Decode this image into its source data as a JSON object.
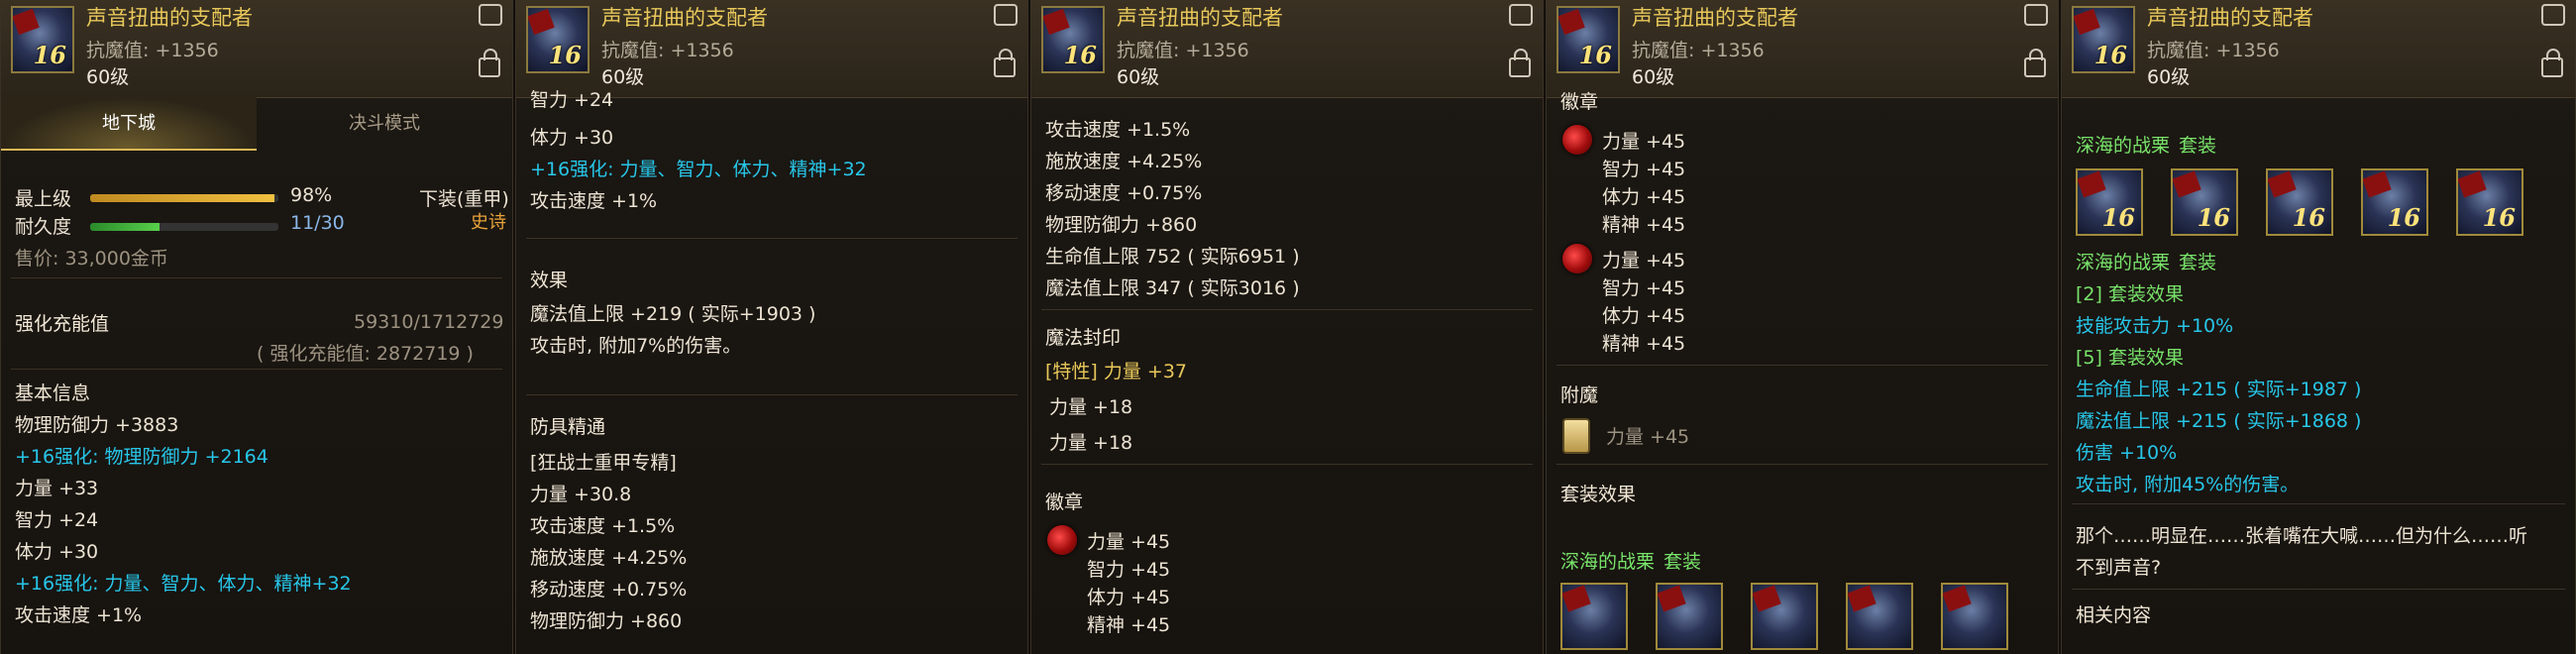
{
  "item": {
    "name": "声音扭曲的支配者",
    "magic_resist": "抗魔值: +1356",
    "level": "60级",
    "icon_level": "16"
  },
  "panel1": {
    "tab_dungeon": "地下城",
    "tab_pvp": "决斗模式",
    "grade_label": "最上级",
    "grade_value": "98%",
    "grade_fraction": 0.98,
    "slot": "下装(重甲)",
    "rarity": "史诗",
    "durability_label": "耐久度",
    "durability_value": "11/30",
    "durability_fraction": 0.3667,
    "price": "售价: 33,000金币",
    "charge_label": "强化充能值",
    "charge_value": "59310/1712729",
    "charge_sub": "( 强化充能值: 2872719 )",
    "basic_info": "基本信息",
    "phys_def": "物理防御力 +3883",
    "reinforce_def": "+16强化: 物理防御力 +2164",
    "str": "力量 +33",
    "int": "智力 +24",
    "vit": "体力 +30",
    "reinforce_stats": "+16强化: 力量、智力、体力、精神+32",
    "atk_speed": "攻击速度 +1%"
  },
  "panel2": {
    "int_partial": "智力 +24",
    "vit": "体力 +30",
    "reinforce_stats": "+16强化: 力量、智力、体力、精神+32",
    "atk_speed": "攻击速度 +1%",
    "effect_head": "效果",
    "effect_mp": "魔法值上限 +219 ( 实际+1903 )",
    "effect_dmg": "攻击时, 附加7%的伤害。",
    "mastery_head": "防具精通",
    "mastery_class": "[狂战士重甲专精]",
    "mastery_str": "力量 +30.8",
    "mastery_atk": "攻击速度 +1.5%",
    "mastery_cast": "施放速度 +4.25%",
    "mastery_move": "移动速度 +0.75%",
    "mastery_def": "物理防御力 +860"
  },
  "panel3": {
    "atk": "攻击速度 +1.5%",
    "cast": "施放速度 +4.25%",
    "move": "移动速度 +0.75%",
    "def": "物理防御力 +860",
    "hp": "生命值上限 752 ( 实际6951 )",
    "mp": "魔法值上限 347 ( 实际3016 )",
    "seal_head": "魔法封印",
    "seal_trait": "[特性] 力量 +37",
    "seal_str1": "力量 +18",
    "seal_str2": "力量 +18",
    "emblem_head": "徽章",
    "emb_str": "力量 +45",
    "emb_int": "智力 +45",
    "emb_vit": "体力 +45",
    "emb_spi": "精神 +45"
  },
  "panel4": {
    "emblem_partial": "徽章",
    "e1_str": "力量 +45",
    "e1_int": "智力 +45",
    "e1_vit": "体力 +45",
    "e1_spi": "精神 +45",
    "e2_str": "力量 +45",
    "e2_int": "智力 +45",
    "e2_vit": "体力 +45",
    "e2_spi": "精神 +45",
    "enchant_head": "附魔",
    "enchant_str": "力量 +45",
    "set_effect_head": "套装效果",
    "set_name": "深海的战栗",
    "set_tag": "套装"
  },
  "panel5": {
    "set_name": "深海的战栗",
    "set_tag": "套装",
    "set_name2": "深海的战栗",
    "set_tag2": "套装",
    "bonus2_head": "[2] 套装效果",
    "bonus2_skill": "技能攻击力 +10%",
    "bonus5_head": "[5] 套装效果",
    "bonus5_hp": "生命值上限 +215 ( 实际+1987 )",
    "bonus5_mp": "魔法值上限 +215 ( 实际+1868 )",
    "bonus5_dmg": "伤害 +10%",
    "bonus5_extra": "攻击时, 附加45%的伤害。",
    "flavor1": "那个……明显在……张着嘴在大喊……但为什么……听",
    "flavor2": "不到声音?",
    "related": "相关内容"
  },
  "colors": {
    "title": "#e8c85a",
    "reinforce": "#27c6e8",
    "set_green": "#78e36a",
    "epic": "#e8a23a"
  }
}
